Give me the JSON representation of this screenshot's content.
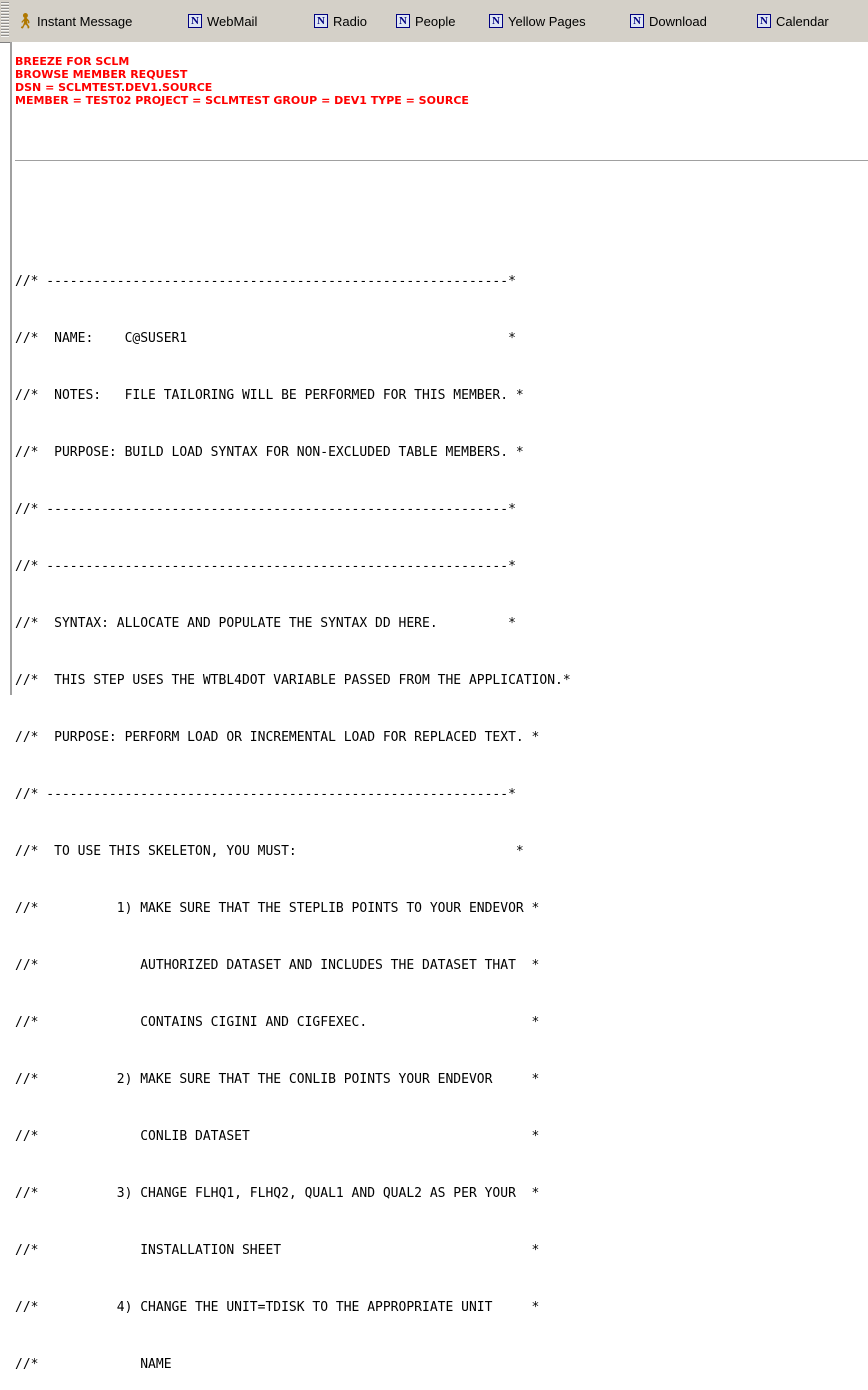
{
  "toolbar": {
    "items": [
      {
        "label": "Instant Message",
        "icon": "person-icon"
      },
      {
        "label": "WebMail",
        "icon": "netscape-n-icon"
      },
      {
        "label": "Radio",
        "icon": "netscape-n-icon"
      },
      {
        "label": "People",
        "icon": "netscape-n-icon"
      },
      {
        "label": "Yellow Pages",
        "icon": "netscape-n-icon"
      },
      {
        "label": "Download",
        "icon": "netscape-n-icon"
      },
      {
        "label": "Calendar",
        "icon": "netscape-n-icon"
      }
    ]
  },
  "header": {
    "color": "#ff0000",
    "lines": [
      "BREEZE FOR SCLM",
      "BROWSE MEMBER REQUEST",
      "DSN = SCLMTEST.DEV1.SOURCE",
      "MEMBER = TEST02 PROJECT = SCLMTEST GROUP = DEV1 TYPE = SOURCE"
    ]
  },
  "listing": {
    "lines": [
      "//* -----------------------------------------------------------*",
      "//*  NAME:    C@SUSER1                                         *",
      "//*  NOTES:   FILE TAILORING WILL BE PERFORMED FOR THIS MEMBER. *",
      "//*  PURPOSE: BUILD LOAD SYNTAX FOR NON-EXCLUDED TABLE MEMBERS. *",
      "//* -----------------------------------------------------------*",
      "//* -----------------------------------------------------------*",
      "//*  SYNTAX: ALLOCATE AND POPULATE THE SYNTAX DD HERE.         *",
      "//*  THIS STEP USES THE WTBL4DOT VARIABLE PASSED FROM THE APPLICATION.*",
      "//*  PURPOSE: PERFORM LOAD OR INCREMENTAL LOAD FOR REPLACED TEXT. *",
      "//* -----------------------------------------------------------*",
      "//*  TO USE THIS SKELETON, YOU MUST:                            *",
      "//*          1) MAKE SURE THAT THE STEPLIB POINTS TO YOUR ENDEVOR *",
      "//*             AUTHORIZED DATASET AND INCLUDES THE DATASET THAT  *",
      "//*             CONTAINS CIGINI AND CIGFEXEC.                     *",
      "//*          2) MAKE SURE THAT THE CONLIB POINTS YOUR ENDEVOR     *",
      "//*             CONLIB DATASET                                    *",
      "//*          3) CHANGE FLHQ1, FLHQ2, QUAL1 AND QUAL2 AS PER YOUR  *",
      "//*             INSTALLATION SHEET                                *",
      "//*          4) CHANGE THE UNIT=TDISK TO THE APPROPRIATE UNIT     *",
      "//*             NAME"
    ]
  }
}
